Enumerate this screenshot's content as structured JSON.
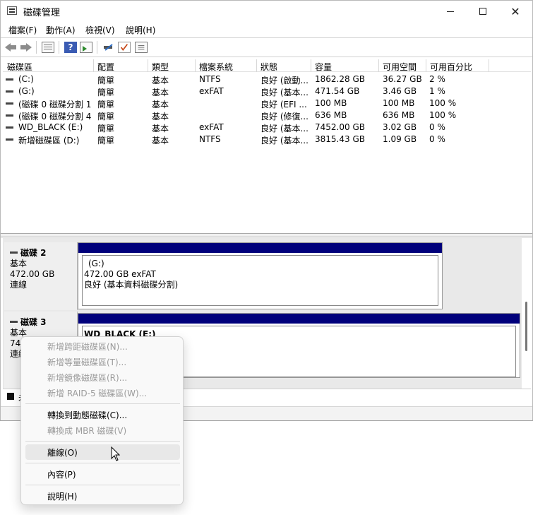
{
  "window": {
    "title": "磁碟管理",
    "min_glyph": "—",
    "max_glyph": "☐",
    "close_glyph": "✕"
  },
  "menubar": {
    "file": "檔案(F)",
    "action": "動作(A)",
    "view": "檢視(V)",
    "help": "說明(H)"
  },
  "toolbar": {
    "icons": [
      "back-arrow-icon",
      "forward-arrow-icon",
      "properties-icon",
      "help-icon",
      "show-pane-icon",
      "connect-drive-icon",
      "checklist-icon",
      "list-view-icon"
    ],
    "help_glyph": "?"
  },
  "volume_list": {
    "columns": [
      "磁碟區",
      "配置",
      "類型",
      "檔案系統",
      "狀態",
      "容量",
      "可用空間",
      "可用百分比"
    ],
    "rows": [
      {
        "volume": "(C:)",
        "layout": "簡單",
        "type": "基本",
        "fs": "NTFS",
        "status": "良好 (啟動...",
        "capacity": "1862.28 GB",
        "free": "36.27 GB",
        "pct": "2 %"
      },
      {
        "volume": "(G:)",
        "layout": "簡單",
        "type": "基本",
        "fs": "exFAT",
        "status": "良好 (基本...",
        "capacity": "471.54 GB",
        "free": "3.46 GB",
        "pct": "1 %"
      },
      {
        "volume": "(磁碟 0 磁碟分割 1)",
        "layout": "簡單",
        "type": "基本",
        "fs": "",
        "status": "良好 (EFI ...",
        "capacity": "100 MB",
        "free": "100 MB",
        "pct": "100 %"
      },
      {
        "volume": "(磁碟 0 磁碟分割 4)",
        "layout": "簡單",
        "type": "基本",
        "fs": "",
        "status": "良好 (修復...",
        "capacity": "636 MB",
        "free": "636 MB",
        "pct": "100 %"
      },
      {
        "volume": "WD_BLACK (E:)",
        "layout": "簡單",
        "type": "基本",
        "fs": "exFAT",
        "status": "良好 (基本...",
        "capacity": "7452.00 GB",
        "free": "3.02 GB",
        "pct": "0 %"
      },
      {
        "volume": "新增磁碟區 (D:)",
        "layout": "簡單",
        "type": "基本",
        "fs": "NTFS",
        "status": "良好 (基本...",
        "capacity": "3815.43 GB",
        "free": "1.09 GB",
        "pct": "0 %"
      }
    ]
  },
  "disks": [
    {
      "name": "磁碟 2",
      "kind": "基本",
      "size": "472.00 GB",
      "state": "連線",
      "partition": {
        "label": "(G:)",
        "size_fs": "472.00 GB exFAT",
        "status": "良好 (基本資料磁碟分割)"
      }
    },
    {
      "name": "磁碟 3",
      "kind": "基本",
      "size": "745",
      "state": "連線",
      "partition": {
        "label": "WD_BLACK  (E:)"
      }
    }
  ],
  "legend": {
    "text": "未"
  },
  "context_menu": {
    "items": [
      {
        "label": "新增跨距磁碟區(N)...",
        "enabled": false
      },
      {
        "label": "新增等量磁碟區(T)...",
        "enabled": false
      },
      {
        "label": "新增鏡像磁碟區(R)...",
        "enabled": false
      },
      {
        "label": "新增 RAID-5 磁碟區(W)...",
        "enabled": false
      },
      {
        "label": "轉換到動態磁碟(C)...",
        "enabled": true
      },
      {
        "label": "轉換成 MBR 磁碟(V)",
        "enabled": false
      },
      {
        "label": "離線(O)",
        "enabled": true,
        "hovered": true
      },
      {
        "label": "內容(P)",
        "enabled": true
      },
      {
        "label": "說明(H)",
        "enabled": true
      }
    ]
  }
}
